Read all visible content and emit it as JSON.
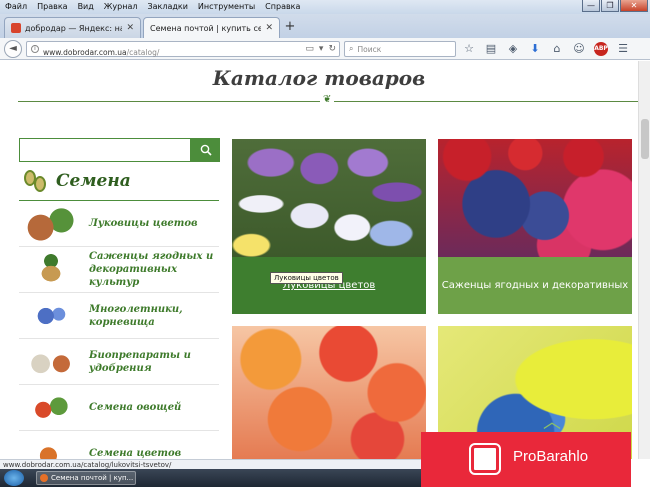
{
  "menubar": {
    "items": [
      "Файл",
      "Правка",
      "Вид",
      "Журнал",
      "Закладки",
      "Инструменты",
      "Справка"
    ]
  },
  "window_controls": {
    "minimize": "—",
    "maximize": "❐",
    "close": "✕"
  },
  "tabs": [
    {
      "title": "добродар — Яндекс: нашла...",
      "active": false
    },
    {
      "title": "Семена почтой | купить семена ...",
      "active": true
    }
  ],
  "new_tab": "+",
  "nav": {
    "back": "◄",
    "info": "i",
    "url_host": "www.dobrodar.com.ua",
    "url_path": "/catalog/",
    "search_placeholder": "Поиск"
  },
  "page": {
    "title": "Каталог товаров",
    "section": "Семена",
    "categories": [
      "Луковицы цветов",
      "Саженцы ягодных и декоративных культур",
      "Многолетники, корневища",
      "Биопрепараты и удобрения",
      "Семена овощей",
      "Семена цветов"
    ],
    "tiles": [
      {
        "caption": "Луковицы цветов"
      },
      {
        "caption": "Саженцы ягодных и декоративных"
      },
      {
        "caption": ""
      },
      {
        "caption": ""
      }
    ],
    "tooltip": "Луковицы цветов"
  },
  "ad": {
    "text": "ProBarahlo"
  },
  "status": {
    "url": "www.dobrodar.com.ua/catalog/lukovitsi-tsvetov/"
  },
  "taskbar": {
    "item": "Семена почтой | куп..."
  },
  "colors": {
    "brand_green": "#4c8d3b",
    "tile_caption": "#3e7e2f",
    "ad_red": "#e9283a"
  }
}
